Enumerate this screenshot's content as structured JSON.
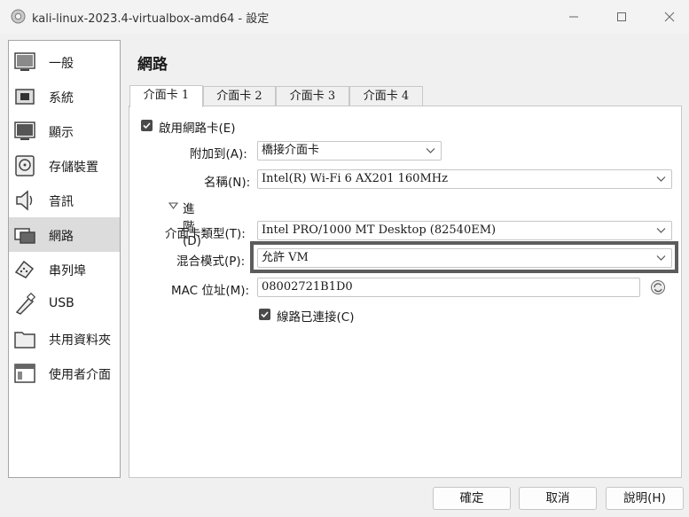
{
  "window": {
    "title": "kali-linux-2023.4-virtualbox-amd64 - 設定"
  },
  "sidebar": {
    "items": [
      {
        "label": "一般",
        "icon": "general-icon"
      },
      {
        "label": "系統",
        "icon": "system-icon"
      },
      {
        "label": "顯示",
        "icon": "display-icon"
      },
      {
        "label": "存儲裝置",
        "icon": "storage-icon"
      },
      {
        "label": "音訊",
        "icon": "audio-icon"
      },
      {
        "label": "網路",
        "icon": "network-icon",
        "selected": true
      },
      {
        "label": "串列埠",
        "icon": "serial-port-icon"
      },
      {
        "label": "USB",
        "icon": "usb-icon"
      },
      {
        "label": "共用資料夾",
        "icon": "shared-folder-icon"
      },
      {
        "label": "使用者介面",
        "icon": "user-interface-icon"
      }
    ]
  },
  "page": {
    "heading": "網路"
  },
  "tabs": [
    {
      "label": "介面卡 1",
      "active": true
    },
    {
      "label": "介面卡 2"
    },
    {
      "label": "介面卡 3"
    },
    {
      "label": "介面卡 4"
    }
  ],
  "form": {
    "enable_label": "啟用網路卡(E)",
    "enable_checked": true,
    "attached_label": "附加到(A):",
    "attached_value": "橋接介面卡",
    "name_label": "名稱(N):",
    "name_value": "Intel(R) Wi-Fi 6 AX201 160MHz",
    "advanced_label": "進階(D)",
    "adapter_type_label": "介面卡類型(T):",
    "adapter_type_value": "Intel PRO/1000 MT Desktop (82540EM)",
    "promisc_label": "混合模式(P):",
    "promisc_value": "允許 VM",
    "mac_label": "MAC 位址(M):",
    "mac_value": "08002721B1D0",
    "cable_label": "線路已連接(C)",
    "cable_checked": true
  },
  "buttons": {
    "ok": "確定",
    "cancel": "取消",
    "help": "說明(H)"
  },
  "colors": {
    "selection": "#dcdcdc",
    "highlight_border": "#5c5c5c",
    "checkbox": "#4a4a4a"
  }
}
